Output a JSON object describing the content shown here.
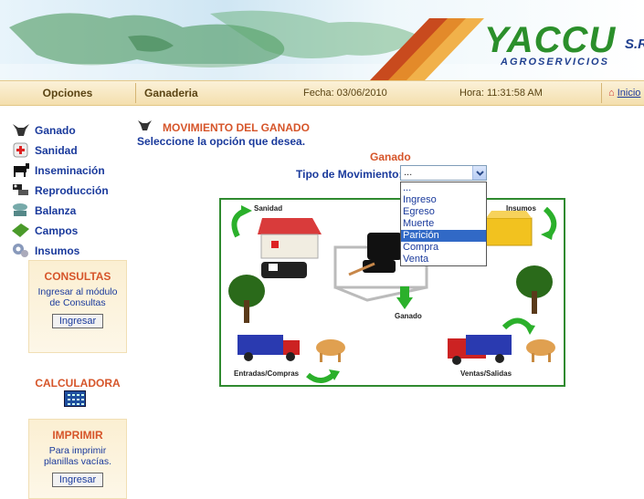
{
  "header": {
    "brand": "YACCU",
    "brand_suffix": "S.R",
    "brand_sub": "AGROSERVICIOS"
  },
  "topbar": {
    "opciones": "Opciones",
    "section": "Ganaderia",
    "fecha": "Fecha: 03/06/2010",
    "hora": "Hora: 11:31:58 AM",
    "inicio": "Inicio"
  },
  "sidebar": {
    "items": [
      {
        "label": "Ganado",
        "icon": "cow-head-icon"
      },
      {
        "label": "Sanidad",
        "icon": "medical-kit-icon"
      },
      {
        "label": "Inseminación",
        "icon": "bull-icon"
      },
      {
        "label": "Reproducción",
        "icon": "cows-icon"
      },
      {
        "label": "Balanza",
        "icon": "scale-icon"
      },
      {
        "label": "Campos",
        "icon": "field-icon"
      },
      {
        "label": "Insumos",
        "icon": "gears-icon"
      }
    ],
    "consultas": {
      "title": "CONSULTAS",
      "text": "Ingresar al módulo de Consultas",
      "button": "Ingresar"
    },
    "calculadora": {
      "title": "CALCULADORA"
    },
    "imprimir": {
      "title": "IMPRIMIR",
      "text": "Para imprimir planillas vacías.",
      "button": "Ingresar"
    }
  },
  "main": {
    "title": "MOVIMIENTO DEL GANADO",
    "subtitle": "Seleccione la opción que desea.",
    "ganado_heading": "Ganado",
    "tipo_label": "Tipo de Movimiento:",
    "select_value": "...",
    "options": [
      "...",
      "Ingreso",
      "Egreso",
      "Muerte",
      "Parición",
      "Compra",
      "Venta"
    ],
    "highlighted_option": "Parición"
  },
  "diagram": {
    "sanidad": "Sanidad",
    "insumos": "Insumos",
    "ganado": "Ganado",
    "entradas": "Entradas/Compras",
    "ventas": "Ventas/Salidas"
  }
}
